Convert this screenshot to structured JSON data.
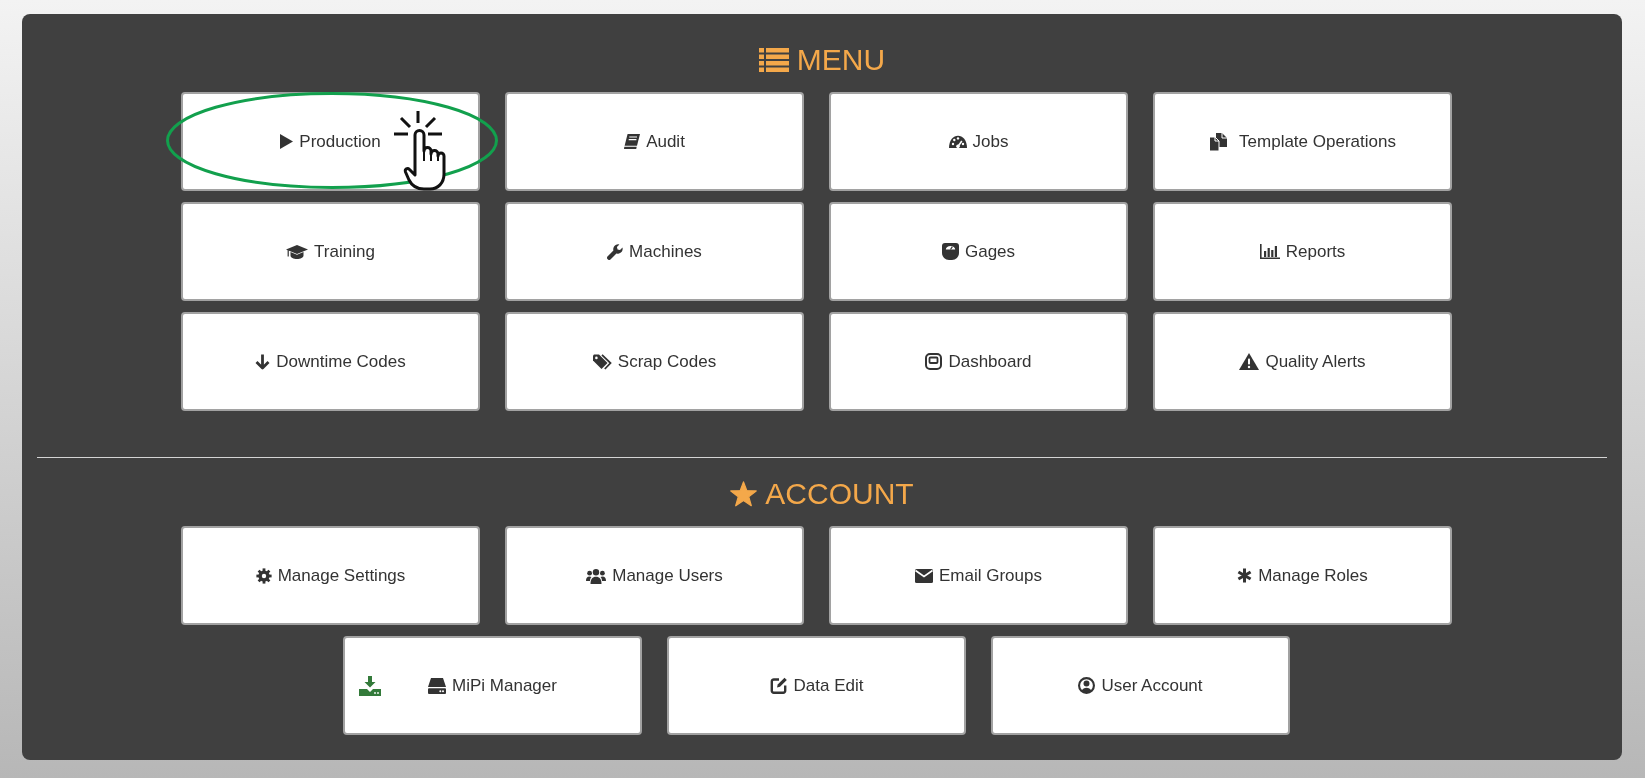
{
  "sections": [
    {
      "kind": "menu",
      "title": "MENU",
      "items": [
        {
          "label": "Production",
          "highlighted": true
        },
        {
          "label": "Audit",
          "highlighted": false
        },
        {
          "label": "Jobs",
          "highlighted": false
        },
        {
          "label": "Template Operations",
          "highlighted": false
        },
        {
          "label": "Training",
          "highlighted": false
        },
        {
          "label": "Machines",
          "highlighted": false
        },
        {
          "label": "Gages",
          "highlighted": false
        },
        {
          "label": "Reports",
          "highlighted": false
        },
        {
          "label": "Downtime Codes",
          "highlighted": false
        },
        {
          "label": "Scrap Codes",
          "highlighted": false
        },
        {
          "label": "Dashboard",
          "highlighted": false
        },
        {
          "label": "Quality Alerts",
          "highlighted": false
        }
      ]
    },
    {
      "kind": "account",
      "title": "ACCOUNT",
      "items": [
        {
          "label": "Manage Settings",
          "highlighted": false
        },
        {
          "label": "Manage Users",
          "highlighted": false
        },
        {
          "label": "Email Groups",
          "highlighted": false
        },
        {
          "label": "Manage Roles",
          "highlighted": false
        },
        {
          "label": "MiPi Manager",
          "highlighted": false
        },
        {
          "label": "Data Edit",
          "highlighted": false
        },
        {
          "label": "User Account",
          "highlighted": false
        }
      ]
    }
  ]
}
